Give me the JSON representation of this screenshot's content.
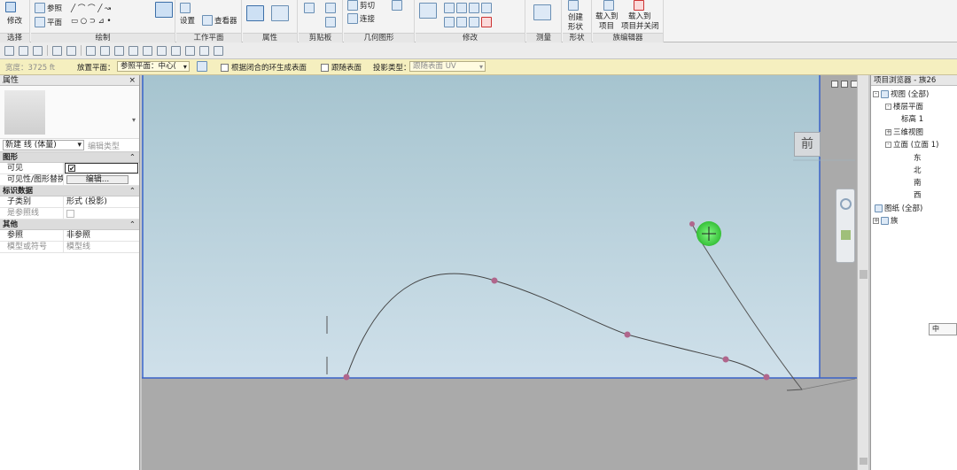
{
  "ribbon": {
    "groups": [
      {
        "label": "选择",
        "buttons": [
          "修改"
        ]
      },
      {
        "label": "绘制",
        "buttons": [
          "参照",
          "平面"
        ]
      },
      {
        "label": "工作平面",
        "buttons": [
          "设置",
          "查看器"
        ]
      },
      {
        "label": "属性",
        "buttons": []
      },
      {
        "label": "剪贴板",
        "buttons": []
      },
      {
        "label": "几何图形",
        "buttons": [
          "剪切",
          "连接"
        ]
      },
      {
        "label": "修改",
        "buttons": []
      },
      {
        "label": "测量",
        "buttons": []
      },
      {
        "label": "形状",
        "buttons": [
          "创建",
          "形状"
        ]
      },
      {
        "label": "族编辑器",
        "buttons": [
          "载入到",
          "项目",
          "载入到",
          "项目并关闭"
        ]
      }
    ]
  },
  "options_bar": {
    "width_label": "宽度：3725 ft",
    "placement_plane_label": "放置平面：",
    "placement_plane_value": "参照平面：中心(",
    "check1_label": "根据闭合的环生成表面",
    "check2_label": "跟随表面",
    "projection_label": "投影类型：",
    "projection_value": "跟随表面 UV"
  },
  "properties": {
    "title": "属性",
    "close": "×",
    "type_selector": "新建 线 (体量)",
    "edit_type": "编辑类型",
    "sections": [
      {
        "name": "图形",
        "rows": [
          {
            "key": "可见",
            "value": "✔",
            "kind": "check"
          },
          {
            "key": "可见性/图形替换",
            "value": "编辑...",
            "kind": "button"
          }
        ]
      },
      {
        "name": "标识数据",
        "rows": [
          {
            "key": "子类别",
            "value": "形式 (投影)",
            "kind": "text"
          },
          {
            "key": "是参照线",
            "value": "",
            "kind": "gray-check"
          }
        ]
      },
      {
        "name": "其他",
        "rows": [
          {
            "key": "参照",
            "value": "非参照",
            "kind": "text"
          },
          {
            "key": "模型或符号",
            "value": "模型线",
            "kind": "gray"
          }
        ]
      }
    ]
  },
  "canvas": {
    "viewcube_label": "前",
    "colors": {
      "sky_top": "#a6c4cf",
      "sky_bottom": "#cfe0ea",
      "ground": "#aaaaaa",
      "frame": "#3a63c8",
      "point": "#b0668c",
      "cursor": "#3fd13f"
    }
  },
  "browser": {
    "title": "项目浏览器 - 族26",
    "items": [
      {
        "label": "视图 (全部)",
        "pm": "-"
      },
      {
        "label": "楼层平面",
        "pm": "-"
      },
      {
        "label": "标高 1",
        "pm": ""
      },
      {
        "label": "三维视图",
        "pm": "+"
      },
      {
        "label": "立面 (立面 1)",
        "pm": "-"
      },
      {
        "label": "东",
        "pm": ""
      },
      {
        "label": "北",
        "pm": ""
      },
      {
        "label": "南",
        "pm": ""
      },
      {
        "label": "西",
        "pm": ""
      },
      {
        "label": "图纸 (全部)",
        "pm": ""
      },
      {
        "label": "族",
        "pm": "+"
      }
    ]
  },
  "mini_box": "中"
}
